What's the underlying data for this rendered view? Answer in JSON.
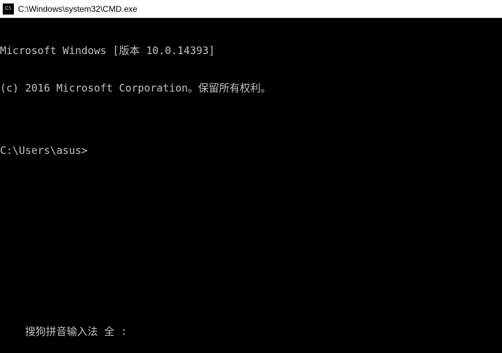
{
  "titlebar": {
    "icon_label": "C:\\.",
    "title": "C:\\Windows\\system32\\CMD.exe"
  },
  "terminal": {
    "line1": "Microsoft Windows [版本 10.0.14393]",
    "line2": "(c) 2016 Microsoft Corporation。保留所有权利。",
    "blank": "",
    "prompt": "C:\\Users\\asus>"
  },
  "ime": {
    "status": "搜狗拼音输入法 全 :"
  }
}
